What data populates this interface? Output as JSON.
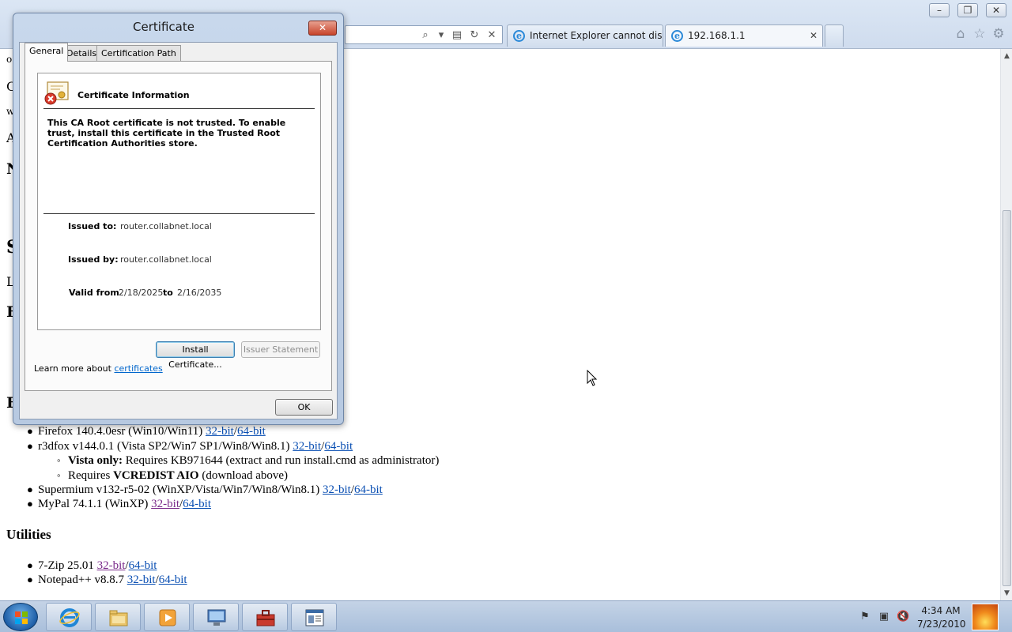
{
  "browser": {
    "tabs": [
      {
        "label": "Internet Explorer cannot displ...",
        "active": false
      },
      {
        "label": "192.168.1.1",
        "active": true
      }
    ],
    "tab_close_glyph": "✕",
    "window_buttons": {
      "minimize": "–",
      "restore": "❐",
      "close": "✕"
    }
  },
  "page": {
    "fragments": [
      "o",
      "C",
      "w",
      "A",
      "N",
      "S",
      "L",
      "F",
      "E"
    ],
    "browsers_list": [
      {
        "name": "Firefox 140.4.0esr (Win10/Win11)",
        "link1": "32-bit",
        "sep": "/",
        "link2": "64-bit"
      },
      {
        "name": "r3dfox v144.0.1 (Vista SP2/Win7 SP1/Win8/Win8.1)",
        "link1": "32-bit",
        "sep": "/",
        "link2": "64-bit"
      },
      {
        "name": "Supermium v132-r5-02 (WinXP/Vista/Win7/Win8/Win8.1)",
        "link1": "32-bit",
        "sep": "/",
        "link2": "64-bit"
      },
      {
        "name": "MyPal 74.1.1 (WinXP)",
        "link1": "32-bit",
        "sep": "/",
        "link2": "64-bit"
      }
    ],
    "r3dfox_notes": [
      {
        "bold": "Vista only:",
        "text": " Requires KB971644 (extract and run install.cmd as administrator)"
      },
      {
        "prefix": "Requires ",
        "bold": "VCREDIST AIO",
        "text": " (download above)"
      }
    ],
    "utilities_heading": "Utilities",
    "utilities_list": [
      {
        "name": "7-Zip 25.01",
        "link1": "32-bit",
        "sep": "/",
        "link2": "64-bit"
      },
      {
        "name": "Notepad++ v8.8.7",
        "link1": "32-bit",
        "sep": "/",
        "link2": "64-bit"
      }
    ]
  },
  "dialog": {
    "title": "Certificate",
    "close_glyph": "✕",
    "tabs": [
      "General",
      "Details",
      "Certification Path"
    ],
    "info_title": "Certificate Information",
    "warning": "This CA Root certificate is not trusted. To enable trust, install this certificate in the Trusted Root Certification Authorities store.",
    "issued_to_label": "Issued to:",
    "issued_to": "router.collabnet.local",
    "issued_by_label": "Issued by:",
    "issued_by": "router.collabnet.local",
    "valid_from_label": "Valid from",
    "valid_from": "2/18/2025",
    "valid_to_label": "to",
    "valid_to": "2/16/2035",
    "install_button": "Install Certificate...",
    "issuer_statement_button": "Issuer Statement",
    "learn_more_prefix": "Learn more about ",
    "learn_more_link": "certificates",
    "ok_button": "OK"
  },
  "taskbar": {
    "items": [
      "internet-explorer",
      "windows-explorer",
      "media-player",
      "control-panel",
      "toolbox",
      "document-viewer"
    ],
    "clock_time": "4:34 AM",
    "clock_date": "7/23/2010"
  },
  "colors": {
    "link": "#0a4fb3",
    "visited_link": "#7a2a8a",
    "dialog_frame": "#c8d8ec",
    "taskbar": "#b6c8e0"
  }
}
